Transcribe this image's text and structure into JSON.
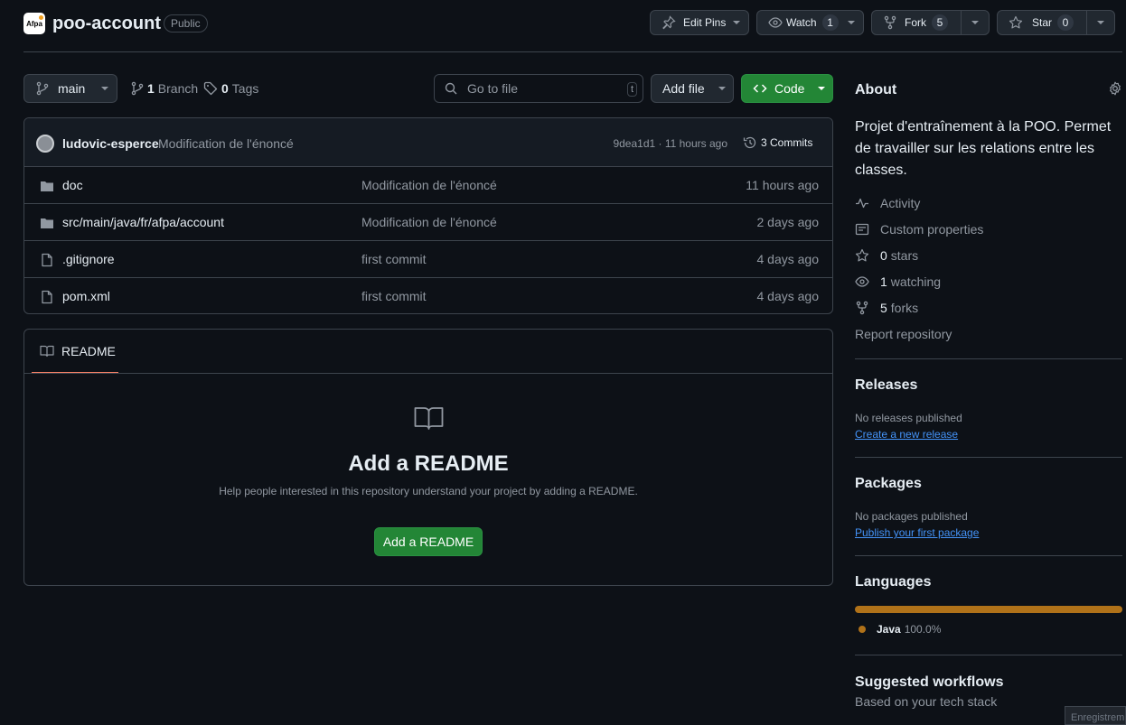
{
  "repo": {
    "owner_avatar_text": "Afpa",
    "name": "poo-account",
    "visibility": "Public"
  },
  "header_actions": {
    "edit_pins": "Edit Pins",
    "watch": "Watch",
    "watch_count": "1",
    "fork": "Fork",
    "fork_count": "5",
    "star": "Star",
    "star_count": "0"
  },
  "toolbar": {
    "branch": "main",
    "branch_count": "1",
    "branch_label": "Branch",
    "tag_count": "0",
    "tag_label": "Tags",
    "goto_placeholder": "Go to file",
    "goto_shortcut": "t",
    "add_file": "Add file",
    "code": "Code"
  },
  "commit": {
    "author": "ludovic-esperce",
    "message": "Modification de l'énoncé",
    "hash_time": "9dea1d1 · 11 hours ago",
    "commits": "3 Commits"
  },
  "files": [
    {
      "type": "folder",
      "name": "doc",
      "message": "Modification de l'énoncé",
      "date": "11 hours ago"
    },
    {
      "type": "folder",
      "name": "src/main/java/fr/afpa/account",
      "message": "Modification de l'énoncé",
      "date": "2 days ago"
    },
    {
      "type": "file",
      "name": ".gitignore",
      "message": "first commit",
      "date": "4 days ago"
    },
    {
      "type": "file",
      "name": "pom.xml",
      "message": "first commit",
      "date": "4 days ago"
    }
  ],
  "readme": {
    "tab": "README",
    "title": "Add a README",
    "description": "Help people interested in this repository understand your project by adding a README.",
    "button": "Add a README"
  },
  "about": {
    "title": "About",
    "description": "Projet d'entraînement à la POO. Permet de travailler sur les relations entre les classes.",
    "activity": "Activity",
    "custom_properties": "Custom properties",
    "stars_count": "0",
    "stars_label": "stars",
    "watching_count": "1",
    "watching_label": "watching",
    "forks_count": "5",
    "forks_label": "forks",
    "report": "Report repository"
  },
  "releases": {
    "title": "Releases",
    "empty": "No releases published",
    "link": "Create a new release"
  },
  "packages": {
    "title": "Packages",
    "empty": "No packages published",
    "link": "Publish your first package"
  },
  "languages": {
    "title": "Languages",
    "items": [
      {
        "name": "Java",
        "percent": "100.0%",
        "color": "#b07219"
      }
    ]
  },
  "workflows": {
    "title": "Suggested workflows",
    "subtitle": "Based on your tech stack"
  },
  "corner_tooltip": "Enregistrem",
  "colors": {
    "background": "#0d1117",
    "border": "#3d444d",
    "green": "#238636",
    "link": "#4493f8",
    "tab_underline": "#f78166"
  }
}
